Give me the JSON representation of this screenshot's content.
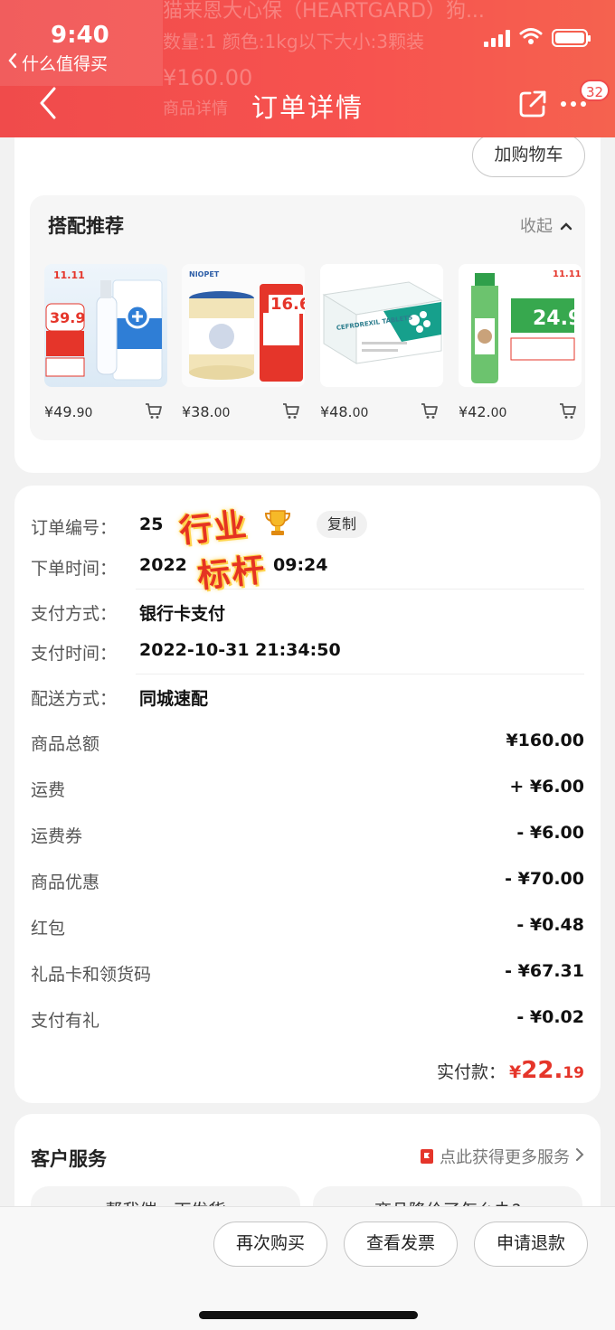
{
  "status_bar": {
    "time": "9:40",
    "back_app": "什么值得买"
  },
  "ghost_text": {
    "line1": "猫来恩大心保（HEARTGARD）狗...",
    "line2": "数量:1 颜色:1kg以下大小:3颗装",
    "line3": "¥160.00",
    "line4": "商品详情"
  },
  "header": {
    "title": "订单详情",
    "badge_count": "32"
  },
  "product_card": {
    "add_cart_label": "加购物车"
  },
  "recommend": {
    "title": "搭配推荐",
    "toggle_label": "收起",
    "items": [
      {
        "price_int": "¥49.",
        "price_dec": "90",
        "promo": "39.9",
        "badge": "11.11"
      },
      {
        "price_int": "¥38.",
        "price_dec": "00",
        "promo": "16.6",
        "brand": "NIOPET"
      },
      {
        "price_int": "¥48.",
        "price_dec": "00",
        "brand": "CEFRDREXIL TABLETS"
      },
      {
        "price_int": "¥42.",
        "price_dec": "00",
        "promo": "24.9",
        "badge": "11.11"
      }
    ]
  },
  "order": {
    "number_label": "订单编号：",
    "number_value": "25",
    "copy_label": "复制",
    "time_label": "下单时间：",
    "time_value": "2022",
    "time_value_tail": "09:24",
    "pay_method_label": "支付方式：",
    "pay_method_value": "银行卡支付",
    "pay_time_label": "支付时间：",
    "pay_time_value": "2022-10-31 21:34:50",
    "delivery_label": "配送方式：",
    "delivery_value": "同城速配",
    "stamp_line1": "行业",
    "stamp_line2": "标杆"
  },
  "amounts": [
    {
      "label": "商品总额",
      "value": "¥160.00"
    },
    {
      "label": "运费",
      "value": "+ ¥6.00"
    },
    {
      "label": "运费券",
      "value": "- ¥6.00"
    },
    {
      "label": "商品优惠",
      "value": "- ¥70.00"
    },
    {
      "label": "红包",
      "value": "- ¥0.48"
    },
    {
      "label": "礼品卡和领货码",
      "value": "- ¥67.31"
    },
    {
      "label": "支付有礼",
      "value": "- ¥0.02"
    }
  ],
  "paid": {
    "label": "实付款：",
    "currency": "¥",
    "integer": "22.",
    "decimal": "19"
  },
  "service": {
    "title": "客户服务",
    "link": "点此获得更多服务",
    "pills": [
      "帮我催一下发货",
      "商品降价了怎么办?"
    ]
  },
  "bottom": {
    "rebuy": "再次购买",
    "invoice": "查看发票",
    "refund": "申请退款"
  },
  "colors": {
    "header_red": "#f04b4b",
    "price_red": "#e5352a"
  }
}
